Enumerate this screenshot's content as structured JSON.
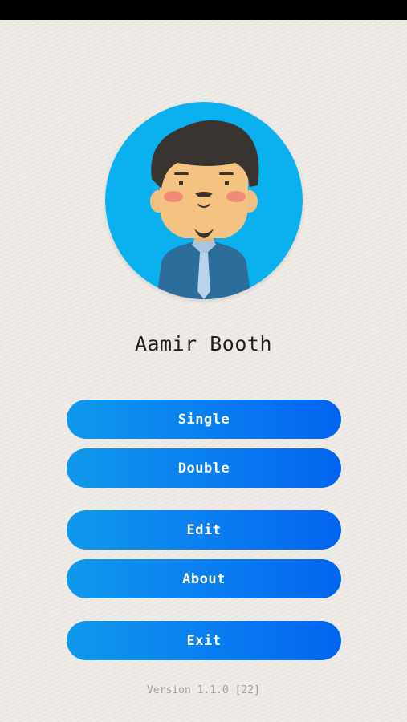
{
  "profile": {
    "name": "Aamir Booth",
    "avatar_icon": "avatar-icon"
  },
  "menu": {
    "single_label": "Single",
    "double_label": "Double",
    "edit_label": "Edit",
    "about_label": "About",
    "exit_label": "Exit"
  },
  "footer": {
    "version": "Version 1.1.0 [22]"
  },
  "colors": {
    "background": "#efece7",
    "button_gradient_start": "#1098ea",
    "button_gradient_end": "#0364ef",
    "avatar_background": "#0bb0ee",
    "status_bar": "#000000"
  }
}
